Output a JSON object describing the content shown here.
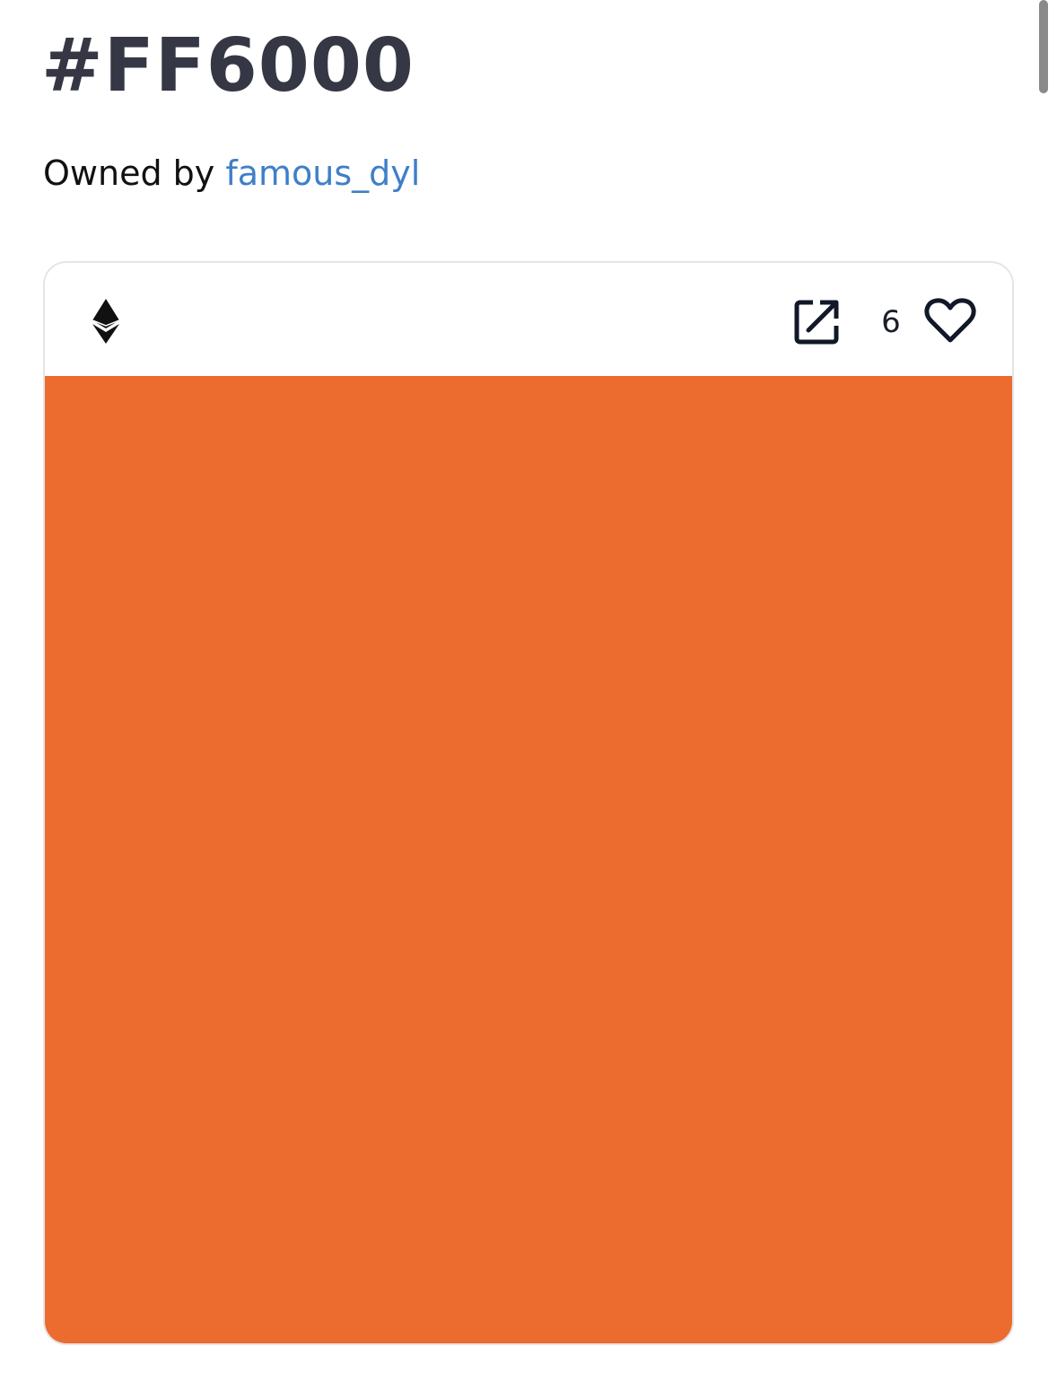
{
  "nft": {
    "title": "#FF6000",
    "owner_prefix": "Owned by ",
    "owner_name": "famous_dyl",
    "like_count": "6",
    "swatch_color": "#EC6B2E"
  },
  "icons": {
    "chain": "ethereum-icon",
    "open": "external-link-icon",
    "like": "heart-outline-icon"
  },
  "colors": {
    "title": "#353844",
    "link": "#3F7FC9",
    "card_border": "#E3E5E8"
  }
}
